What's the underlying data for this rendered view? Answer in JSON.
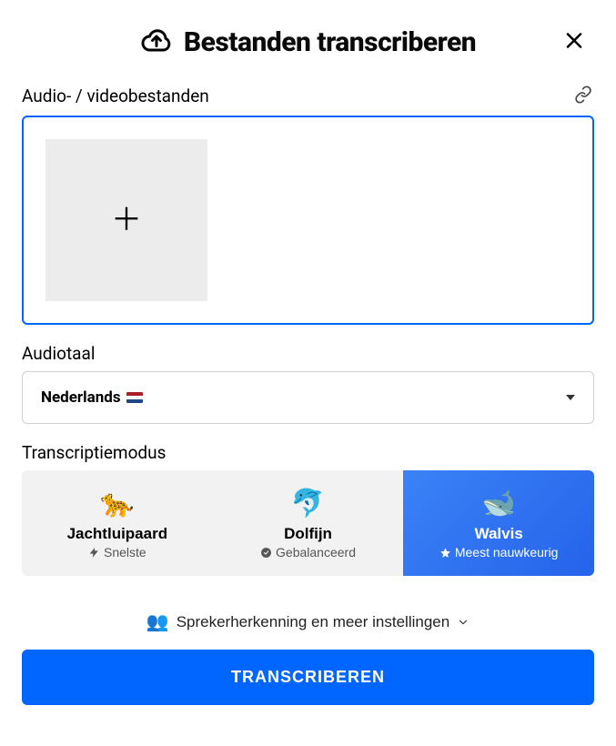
{
  "header": {
    "title": "Bestanden transcriberen"
  },
  "files": {
    "label": "Audio- / videobestanden"
  },
  "language": {
    "label": "Audiotaal",
    "selected": "Nederlands"
  },
  "mode": {
    "label": "Transcriptiemodus",
    "options": [
      {
        "emoji": "🐆",
        "name": "Jachtluipaard",
        "tag": "Snelste",
        "tag_icon": "bolt",
        "selected": false
      },
      {
        "emoji": "🐬",
        "name": "Dolfijn",
        "tag": "Gebalanceerd",
        "tag_icon": "check-circle",
        "selected": false
      },
      {
        "emoji": "🐋",
        "name": "Walvis",
        "tag": "Meest nauwkeurig",
        "tag_icon": "star",
        "selected": true
      }
    ]
  },
  "more_settings": {
    "label": "Sprekerherkenning en meer instellingen",
    "emoji": "👥"
  },
  "submit": {
    "label": "TRANSCRIBEREN"
  }
}
